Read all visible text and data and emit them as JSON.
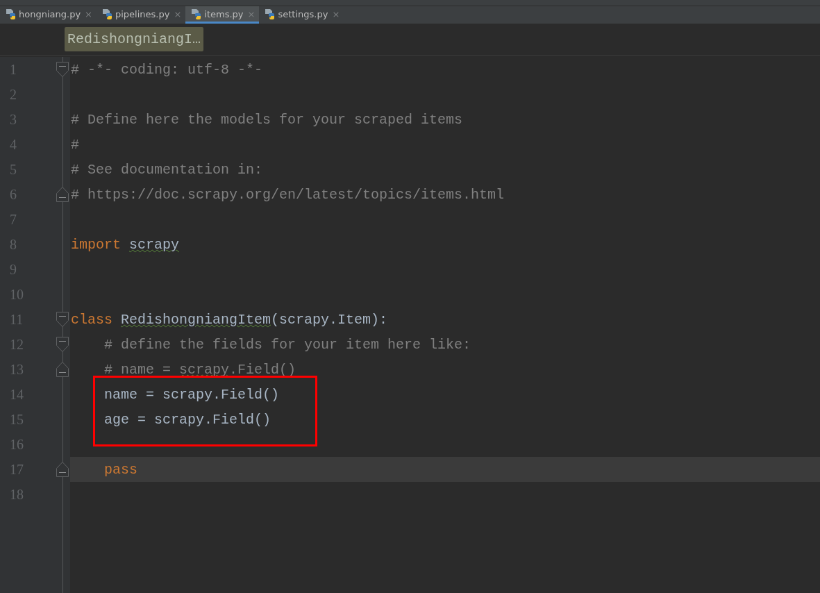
{
  "tabs": [
    {
      "label": "hongniang.py",
      "close": "×",
      "selected": false
    },
    {
      "label": "pipelines.py",
      "close": "×",
      "selected": false
    },
    {
      "label": "items.py",
      "close": "×",
      "selected": true
    },
    {
      "label": "settings.py",
      "close": "×",
      "selected": false
    }
  ],
  "breadcrumb": {
    "label": "RedishongniangI…"
  },
  "lines": [
    {
      "number": "1",
      "fold_start": true,
      "fold_end": false,
      "current": false,
      "boxed": false,
      "tokens": [
        {
          "text": "# -*- coding: utf-8 -*-",
          "kind": "comment",
          "squiggle": false
        }
      ]
    },
    {
      "number": "2",
      "fold_start": false,
      "fold_end": false,
      "current": false,
      "boxed": false
    },
    {
      "number": "3",
      "fold_start": false,
      "fold_end": false,
      "current": false,
      "boxed": false,
      "tokens": [
        {
          "text": "# Define here the models for your scraped items",
          "kind": "comment",
          "squiggle": false
        }
      ]
    },
    {
      "number": "4",
      "fold_start": false,
      "fold_end": false,
      "current": false,
      "boxed": false,
      "tokens": [
        {
          "text": "#",
          "kind": "comment",
          "squiggle": false
        }
      ]
    },
    {
      "number": "5",
      "fold_start": false,
      "fold_end": false,
      "current": false,
      "boxed": false,
      "tokens": [
        {
          "text": "# See documentation in:",
          "kind": "comment",
          "squiggle": false
        }
      ]
    },
    {
      "number": "6",
      "fold_start": false,
      "fold_end": true,
      "current": false,
      "boxed": false,
      "tokens": [
        {
          "text": "# https://doc.scrapy.org/en/latest/topics/items.html",
          "kind": "comment",
          "squiggle": false
        }
      ]
    },
    {
      "number": "7",
      "fold_start": false,
      "fold_end": false,
      "current": false,
      "boxed": false
    },
    {
      "number": "8",
      "fold_start": false,
      "fold_end": false,
      "current": false,
      "boxed": false,
      "tokens": [
        {
          "text": "import ",
          "kind": "keyword",
          "squiggle": false
        },
        {
          "text": "scrapy",
          "kind": "plain",
          "squiggle": true
        }
      ]
    },
    {
      "number": "9",
      "fold_start": false,
      "fold_end": false,
      "current": false,
      "boxed": false
    },
    {
      "number": "10",
      "fold_start": false,
      "fold_end": false,
      "current": false,
      "boxed": false
    },
    {
      "number": "11",
      "fold_start": true,
      "fold_end": false,
      "current": false,
      "boxed": false,
      "tokens": [
        {
          "text": "class ",
          "kind": "keyword",
          "squiggle": false
        },
        {
          "text": "RedishongniangItem",
          "kind": "plain",
          "squiggle": true
        },
        {
          "text": "(scrapy.Item):",
          "kind": "plain",
          "squiggle": false
        }
      ]
    },
    {
      "number": "12",
      "fold_start": true,
      "fold_end": false,
      "current": false,
      "boxed": false,
      "tokens": [
        {
          "text": "    # define the fields for your item here like:",
          "kind": "comment",
          "squiggle": false
        }
      ]
    },
    {
      "number": "13",
      "fold_start": false,
      "fold_end": true,
      "current": false,
      "boxed": false,
      "tokens": [
        {
          "text": "    # name = ",
          "kind": "comment",
          "squiggle": false
        },
        {
          "text": "scrapy",
          "kind": "comment",
          "squiggle": true
        },
        {
          "text": ".Field()",
          "kind": "comment",
          "squiggle": false
        }
      ]
    },
    {
      "number": "14",
      "fold_start": false,
      "fold_end": false,
      "current": false,
      "boxed": true,
      "tokens": [
        {
          "text": "    name = scrapy.Field()",
          "kind": "plain",
          "squiggle": false
        }
      ]
    },
    {
      "number": "15",
      "fold_start": false,
      "fold_end": false,
      "current": false,
      "boxed": true,
      "tokens": [
        {
          "text": "    age = scrapy.Field()",
          "kind": "plain",
          "squiggle": false
        }
      ]
    },
    {
      "number": "16",
      "fold_start": false,
      "fold_end": false,
      "current": false,
      "boxed": true
    },
    {
      "number": "17",
      "fold_start": false,
      "fold_end": true,
      "current": true,
      "boxed": false,
      "tokens": [
        {
          "text": "    pass",
          "kind": "keyword",
          "squiggle": false
        }
      ]
    },
    {
      "number": "18",
      "fold_start": false,
      "fold_end": false,
      "current": false,
      "boxed": false
    }
  ]
}
